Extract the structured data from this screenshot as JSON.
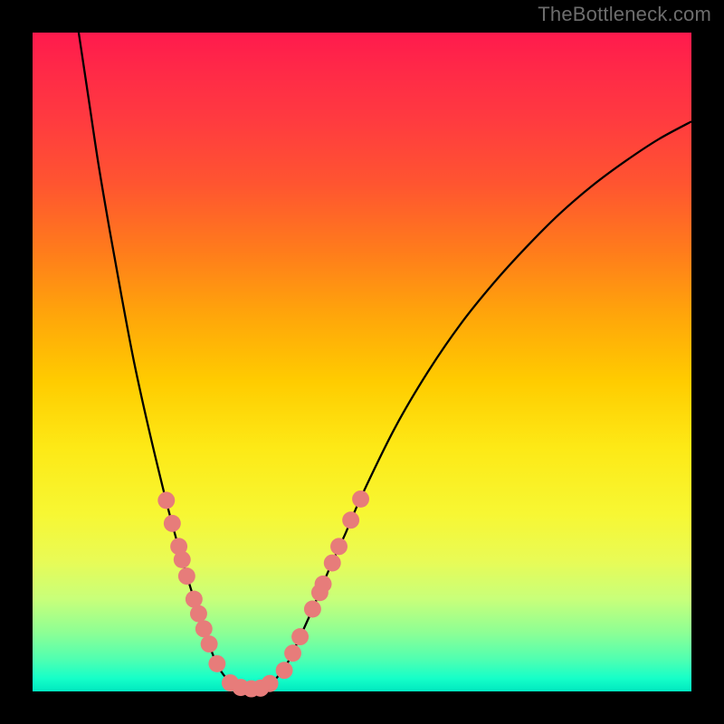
{
  "watermark": "TheBottleneck.com",
  "chart_data": {
    "type": "line",
    "title": "",
    "xlabel": "",
    "ylabel": "",
    "xlim": [
      0,
      100
    ],
    "ylim": [
      0,
      100
    ],
    "grid": false,
    "series": [
      {
        "name": "curve",
        "stroke": "#000000",
        "points": [
          {
            "x": 7.0,
            "y": 100.0
          },
          {
            "x": 8.5,
            "y": 90.0
          },
          {
            "x": 10.0,
            "y": 80.0
          },
          {
            "x": 11.7,
            "y": 70.0
          },
          {
            "x": 13.5,
            "y": 60.0
          },
          {
            "x": 15.4,
            "y": 50.0
          },
          {
            "x": 17.6,
            "y": 40.0
          },
          {
            "x": 20.0,
            "y": 30.0
          },
          {
            "x": 21.3,
            "y": 25.0
          },
          {
            "x": 22.7,
            "y": 20.0
          },
          {
            "x": 24.2,
            "y": 15.0
          },
          {
            "x": 25.8,
            "y": 10.0
          },
          {
            "x": 27.6,
            "y": 5.0
          },
          {
            "x": 29.0,
            "y": 2.5
          },
          {
            "x": 30.8,
            "y": 1.0
          },
          {
            "x": 32.8,
            "y": 0.4
          },
          {
            "x": 34.8,
            "y": 0.6
          },
          {
            "x": 36.5,
            "y": 1.5
          },
          {
            "x": 38.5,
            "y": 4.0
          },
          {
            "x": 40.0,
            "y": 7.0
          },
          {
            "x": 42.5,
            "y": 12.5
          },
          {
            "x": 45.0,
            "y": 18.5
          },
          {
            "x": 47.5,
            "y": 24.0
          },
          {
            "x": 50.0,
            "y": 29.8
          },
          {
            "x": 55.0,
            "y": 40.0
          },
          {
            "x": 60.0,
            "y": 48.5
          },
          {
            "x": 65.0,
            "y": 55.8
          },
          {
            "x": 70.0,
            "y": 62.0
          },
          {
            "x": 75.0,
            "y": 67.5
          },
          {
            "x": 80.0,
            "y": 72.5
          },
          {
            "x": 85.0,
            "y": 76.8
          },
          {
            "x": 90.0,
            "y": 80.5
          },
          {
            "x": 95.0,
            "y": 83.8
          },
          {
            "x": 100.0,
            "y": 86.5
          }
        ]
      }
    ],
    "markers": {
      "color": "#e77c7a",
      "radius_data_units": 1.3,
      "points": [
        {
          "x": 20.3,
          "y": 29.0
        },
        {
          "x": 21.2,
          "y": 25.5
        },
        {
          "x": 22.2,
          "y": 22.0
        },
        {
          "x": 22.7,
          "y": 20.0
        },
        {
          "x": 23.4,
          "y": 17.5
        },
        {
          "x": 24.5,
          "y": 14.0
        },
        {
          "x": 25.2,
          "y": 11.8
        },
        {
          "x": 26.0,
          "y": 9.5
        },
        {
          "x": 26.8,
          "y": 7.2
        },
        {
          "x": 28.0,
          "y": 4.2
        },
        {
          "x": 30.0,
          "y": 1.3
        },
        {
          "x": 31.6,
          "y": 0.6
        },
        {
          "x": 33.2,
          "y": 0.4
        },
        {
          "x": 34.6,
          "y": 0.5
        },
        {
          "x": 36.0,
          "y": 1.2
        },
        {
          "x": 38.2,
          "y": 3.2
        },
        {
          "x": 39.5,
          "y": 5.8
        },
        {
          "x": 40.6,
          "y": 8.3
        },
        {
          "x": 42.5,
          "y": 12.5
        },
        {
          "x": 43.6,
          "y": 15.0
        },
        {
          "x": 44.1,
          "y": 16.3
        },
        {
          "x": 45.5,
          "y": 19.5
        },
        {
          "x": 46.5,
          "y": 22.0
        },
        {
          "x": 48.3,
          "y": 26.0
        },
        {
          "x": 49.8,
          "y": 29.2
        }
      ]
    },
    "background_gradient": {
      "direction": "vertical",
      "stops": [
        {
          "pos": 0.0,
          "color": "#ff1a4d"
        },
        {
          "pos": 0.23,
          "color": "#ff5530"
        },
        {
          "pos": 0.53,
          "color": "#ffcc00"
        },
        {
          "pos": 0.8,
          "color": "#e9fb55"
        },
        {
          "pos": 1.0,
          "color": "#00e8c0"
        }
      ]
    }
  }
}
